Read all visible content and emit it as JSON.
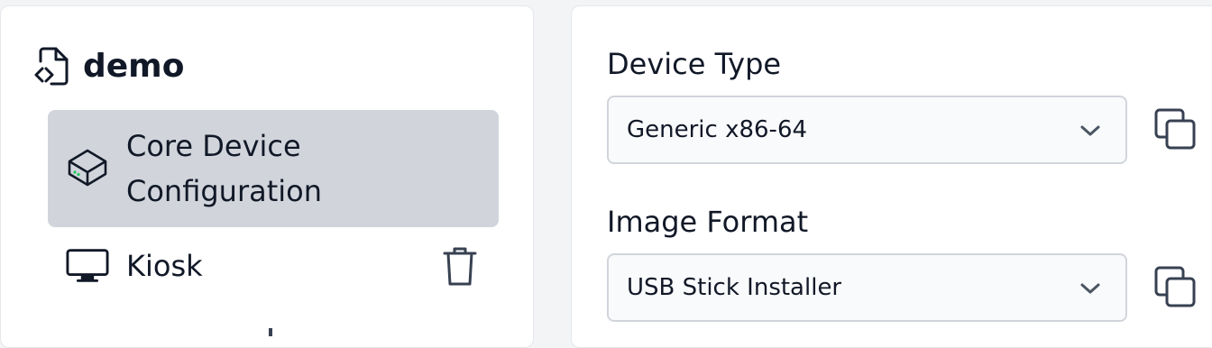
{
  "sidebar": {
    "project": {
      "title": "demo",
      "icon": "file-code-icon"
    },
    "items": [
      {
        "label": "Core Device Configuration",
        "icon": "device-box-icon",
        "selected": true
      },
      {
        "label": "Kiosk",
        "icon": "monitor-icon",
        "selected": false,
        "action_icon": "trash-icon"
      }
    ]
  },
  "form": {
    "device_type": {
      "label": "Device Type",
      "value": "Generic x86-64",
      "copy_icon": "copy-icon"
    },
    "image_format": {
      "label": "Image Format",
      "value": "USB Stick Installer",
      "copy_icon": "copy-icon"
    }
  },
  "colors": {
    "selected_bg": "#d1d5db",
    "text": "#111827",
    "icon": "#374151",
    "led_green": "#22c55e",
    "input_bg": "#f9fafb",
    "input_border": "#d1d5db"
  }
}
